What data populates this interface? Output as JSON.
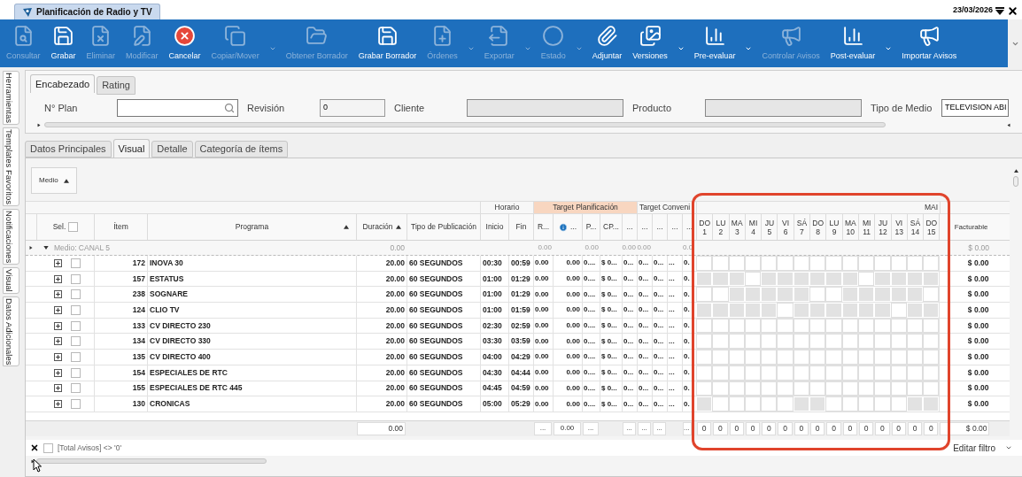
{
  "title_bar": {
    "tab": "Planificación de Radio y TV",
    "date": "23/03/2026"
  },
  "toolbar": [
    {
      "label": "Consultar",
      "disabled": true,
      "dropdown": false
    },
    {
      "label": "Grabar",
      "disabled": false,
      "dropdown": false
    },
    {
      "label": "Eliminar",
      "disabled": true,
      "dropdown": false
    },
    {
      "label": "Modificar",
      "disabled": true,
      "dropdown": false
    },
    {
      "label": "Cancelar",
      "disabled": false,
      "dropdown": false
    },
    {
      "label": "Copiar/Mover",
      "disabled": true,
      "dropdown": true
    },
    {
      "label": "Obtener Borrador",
      "disabled": true,
      "dropdown": false
    },
    {
      "label": "Grabar Borrador",
      "disabled": false,
      "dropdown": false
    },
    {
      "label": "Órdenes",
      "disabled": true,
      "dropdown": true
    },
    {
      "label": "Exportar",
      "disabled": true,
      "dropdown": true
    },
    {
      "label": "Estado",
      "disabled": true,
      "dropdown": true
    },
    {
      "label": "Adjuntar",
      "disabled": false,
      "dropdown": false
    },
    {
      "label": "Versiones",
      "disabled": false,
      "dropdown": true
    },
    {
      "label": "Pre-evaluar",
      "disabled": false,
      "dropdown": true
    },
    {
      "label": "Controlar Avisos",
      "disabled": true,
      "dropdown": false
    },
    {
      "label": "Post-evaluar",
      "disabled": false,
      "dropdown": true
    },
    {
      "label": "Importar Avisos",
      "disabled": false,
      "dropdown": false
    }
  ],
  "side_tabs": [
    {
      "label": "Herramientas"
    },
    {
      "label": "Templates Favoritos"
    },
    {
      "label": "Notificaciones"
    },
    {
      "label": "Visual"
    },
    {
      "label": "Datos Adicionales"
    }
  ],
  "header": {
    "tabs": [
      {
        "label": "Encabezado",
        "selected": true
      },
      {
        "label": "Rating",
        "selected": false
      }
    ],
    "fields": [
      {
        "label": "N° Plan",
        "kind": "search"
      },
      {
        "label": "Revisión",
        "kind": "readonly",
        "value": "0"
      },
      {
        "label": "Cliente",
        "kind": "blurred"
      },
      {
        "label": "Producto",
        "kind": "blurred"
      },
      {
        "label": "Tipo de Medio",
        "kind": "text",
        "value": "TELEVISION ABI"
      }
    ]
  },
  "detail_tabs": [
    {
      "label": "Datos Principales",
      "selected": false
    },
    {
      "label": "Visual",
      "selected": true
    },
    {
      "label": "Detalle",
      "selected": false
    },
    {
      "label": "Categoría de ítems",
      "selected": false
    }
  ],
  "grid": {
    "group_button": "Medio",
    "bands": [
      {
        "label": "Horario",
        "kind": "plain"
      },
      {
        "label": "Target Planificación",
        "kind": "highlight"
      },
      {
        "label": "Target Conveni",
        "kind": "plain"
      }
    ],
    "day_band": "MAI",
    "columns": [
      {
        "label": "Sel.",
        "kind": "select",
        "checked": false,
        "sorted": false
      },
      {
        "label": "Ítem",
        "sorted": false
      },
      {
        "label": "Programa",
        "sorted": true
      },
      {
        "label": "Duración",
        "sorted": true
      },
      {
        "label": "Tipo de Publicación",
        "sorted": false
      },
      {
        "label": "Inicio",
        "sorted": false
      },
      {
        "label": "Fin",
        "sorted": false
      },
      {
        "label": "R...",
        "sorted": false
      },
      {
        "label": "...",
        "kind": "info",
        "sorted": false
      },
      {
        "label": "P...",
        "sorted": false
      },
      {
        "label": "CP...",
        "sorted": false
      },
      {
        "label": "...",
        "sorted": false
      },
      {
        "label": "...",
        "sorted": false
      },
      {
        "label": "...",
        "sorted": false
      },
      {
        "label": "...",
        "sorted": false
      },
      {
        "label": "...",
        "sorted": false
      }
    ],
    "days": [
      {
        "weekday": "DO",
        "day": "1"
      },
      {
        "weekday": "LU",
        "day": "2"
      },
      {
        "weekday": "MA",
        "day": "3"
      },
      {
        "weekday": "MI",
        "day": "4"
      },
      {
        "weekday": "JU",
        "day": "5"
      },
      {
        "weekday": "VI",
        "day": "6"
      },
      {
        "weekday": "SÁ",
        "day": "7"
      },
      {
        "weekday": "DO",
        "day": "8"
      },
      {
        "weekday": "LU",
        "day": "9"
      },
      {
        "weekday": "MA",
        "day": "10"
      },
      {
        "weekday": "MI",
        "day": "11"
      },
      {
        "weekday": "JU",
        "day": "12"
      },
      {
        "weekday": "VI",
        "day": "13"
      },
      {
        "weekday": "SÁ",
        "day": "14"
      },
      {
        "weekday": "DO",
        "day": "15"
      }
    ],
    "total_column": "Facturable",
    "group_row": {
      "label": "Medio: CANAL 5",
      "expanded": true,
      "duration": "0.00",
      "metrics": {
        "r": "0.00",
        "p": "0.00",
        "m1": "0.00",
        "m2": "0.00",
        "m5": "0.0"
      },
      "total": "$ 0.00"
    },
    "rows": [
      {
        "item": "172",
        "program": "INOVA 30",
        "duration": "20.00",
        "type": "60 SEGUNDOS",
        "start": "00:30",
        "end": "00:59",
        "metrics": [
          "0.00",
          "0.00",
          "0....",
          "$ 0...",
          "0...",
          "0...",
          "0...",
          "...",
          "0."
        ],
        "blocked_days": [
          false,
          false,
          false,
          false,
          false,
          false,
          false,
          false,
          false,
          false,
          false,
          false,
          false,
          false,
          false
        ],
        "total": "$ 0.00",
        "checked": false,
        "expanded": false
      },
      {
        "item": "157",
        "program": "ESTATUS",
        "duration": "20.00",
        "type": "60 SEGUNDOS",
        "start": "01:00",
        "end": "01:29",
        "metrics": [
          "0.00",
          "0.00",
          "0....",
          "$ 0...",
          "0...",
          "0...",
          "0...",
          "...",
          "0."
        ],
        "blocked_days": [
          true,
          true,
          true,
          false,
          true,
          true,
          true,
          true,
          true,
          true,
          false,
          true,
          true,
          true,
          true
        ],
        "total": "$ 0.00",
        "checked": false,
        "expanded": false
      },
      {
        "item": "238",
        "program": "SOGNARE",
        "duration": "20.00",
        "type": "60 SEGUNDOS",
        "start": "01:00",
        "end": "01:29",
        "metrics": [
          "0.00",
          "0.00",
          "0....",
          "$ 0...",
          "0...",
          "0...",
          "0...",
          "...",
          "0."
        ],
        "blocked_days": [
          false,
          false,
          true,
          true,
          true,
          true,
          true,
          false,
          false,
          true,
          true,
          true,
          true,
          true,
          false
        ],
        "total": "$ 0.00",
        "checked": false,
        "expanded": false
      },
      {
        "item": "124",
        "program": "CLIO TV",
        "duration": "20.00",
        "type": "60 SEGUNDOS",
        "start": "01:00",
        "end": "01:59",
        "metrics": [
          "0.00",
          "0.00",
          "0....",
          "$ 0...",
          "0...",
          "0...",
          "0...",
          "...",
          "0."
        ],
        "blocked_days": [
          true,
          true,
          true,
          true,
          true,
          false,
          true,
          true,
          true,
          true,
          true,
          true,
          false,
          true,
          true
        ],
        "total": "$ 0.00",
        "checked": false,
        "expanded": false
      },
      {
        "item": "133",
        "program": "CV DIRECTO 230",
        "duration": "20.00",
        "type": "60 SEGUNDOS",
        "start": "02:30",
        "end": "02:59",
        "metrics": [
          "0.00",
          "0.00",
          "0....",
          "$ 0...",
          "0...",
          "0...",
          "0...",
          "...",
          "0."
        ],
        "blocked_days": [
          false,
          false,
          false,
          false,
          false,
          false,
          false,
          false,
          false,
          false,
          false,
          false,
          false,
          false,
          false
        ],
        "total": "$ 0.00",
        "checked": false,
        "expanded": false
      },
      {
        "item": "134",
        "program": "CV DIRECTO 330",
        "duration": "20.00",
        "type": "60 SEGUNDOS",
        "start": "03:30",
        "end": "03:59",
        "metrics": [
          "0.00",
          "0.00",
          "0....",
          "$ 0...",
          "0...",
          "0...",
          "0...",
          "...",
          "0."
        ],
        "blocked_days": [
          false,
          false,
          false,
          false,
          false,
          false,
          false,
          false,
          false,
          false,
          false,
          false,
          false,
          false,
          false
        ],
        "total": "$ 0.00",
        "checked": false,
        "expanded": false
      },
      {
        "item": "135",
        "program": "CV DIRECTO 400",
        "duration": "20.00",
        "type": "60 SEGUNDOS",
        "start": "04:00",
        "end": "04:29",
        "metrics": [
          "0.00",
          "0.00",
          "0....",
          "$ 0...",
          "0...",
          "0...",
          "0...",
          "...",
          "0."
        ],
        "blocked_days": [
          false,
          false,
          false,
          false,
          false,
          false,
          false,
          false,
          false,
          false,
          false,
          false,
          false,
          false,
          false
        ],
        "total": "$ 0.00",
        "checked": false,
        "expanded": false
      },
      {
        "item": "154",
        "program": "ESPECIALES DE RTC",
        "duration": "20.00",
        "type": "60 SEGUNDOS",
        "start": "04:30",
        "end": "04:44",
        "metrics": [
          "0.00",
          "0.00",
          "0....",
          "$ 0...",
          "0...",
          "0...",
          "0...",
          "...",
          "0."
        ],
        "blocked_days": [
          false,
          false,
          false,
          false,
          false,
          false,
          false,
          false,
          false,
          false,
          false,
          false,
          false,
          false,
          false
        ],
        "total": "$ 0.00",
        "checked": false,
        "expanded": false
      },
      {
        "item": "155",
        "program": "ESPECIALES DE RTC 445",
        "duration": "20.00",
        "type": "60 SEGUNDOS",
        "start": "04:45",
        "end": "04:59",
        "metrics": [
          "0.00",
          "0.00",
          "0....",
          "$ 0...",
          "0...",
          "0...",
          "0...",
          "...",
          "0."
        ],
        "blocked_days": [
          false,
          false,
          false,
          false,
          false,
          false,
          false,
          false,
          false,
          false,
          false,
          false,
          false,
          false,
          false
        ],
        "total": "$ 0.00",
        "checked": false,
        "expanded": false
      },
      {
        "item": "130",
        "program": "CRONICAS",
        "duration": "20.00",
        "type": "60 SEGUNDOS",
        "start": "05:00",
        "end": "05:29",
        "metrics": [
          "0.00",
          "0.00",
          "0....",
          "$ 0...",
          "0...",
          "0...",
          "0...",
          "...",
          "0."
        ],
        "blocked_days": [
          true,
          false,
          false,
          false,
          false,
          false,
          true,
          true,
          false,
          false,
          false,
          false,
          false,
          true,
          true
        ],
        "total": "$ 0.00",
        "checked": false,
        "expanded": false
      }
    ],
    "footer": {
      "duration": "0.00",
      "metrics": {
        "r": "...",
        "info": "0.00",
        "p": "...",
        "m1": "...",
        "m2": "...",
        "m3": "...",
        "m5": "..."
      },
      "day_totals": [
        "0",
        "0",
        "0",
        "0",
        "0",
        "0",
        "0",
        "0",
        "0",
        "0",
        "0",
        "0",
        "0",
        "0",
        "0"
      ],
      "total": "$ 0.00"
    },
    "filter": {
      "text": "[Total Avisos] <> '0'",
      "checked": false,
      "edit_label": "Editar filtro"
    }
  }
}
